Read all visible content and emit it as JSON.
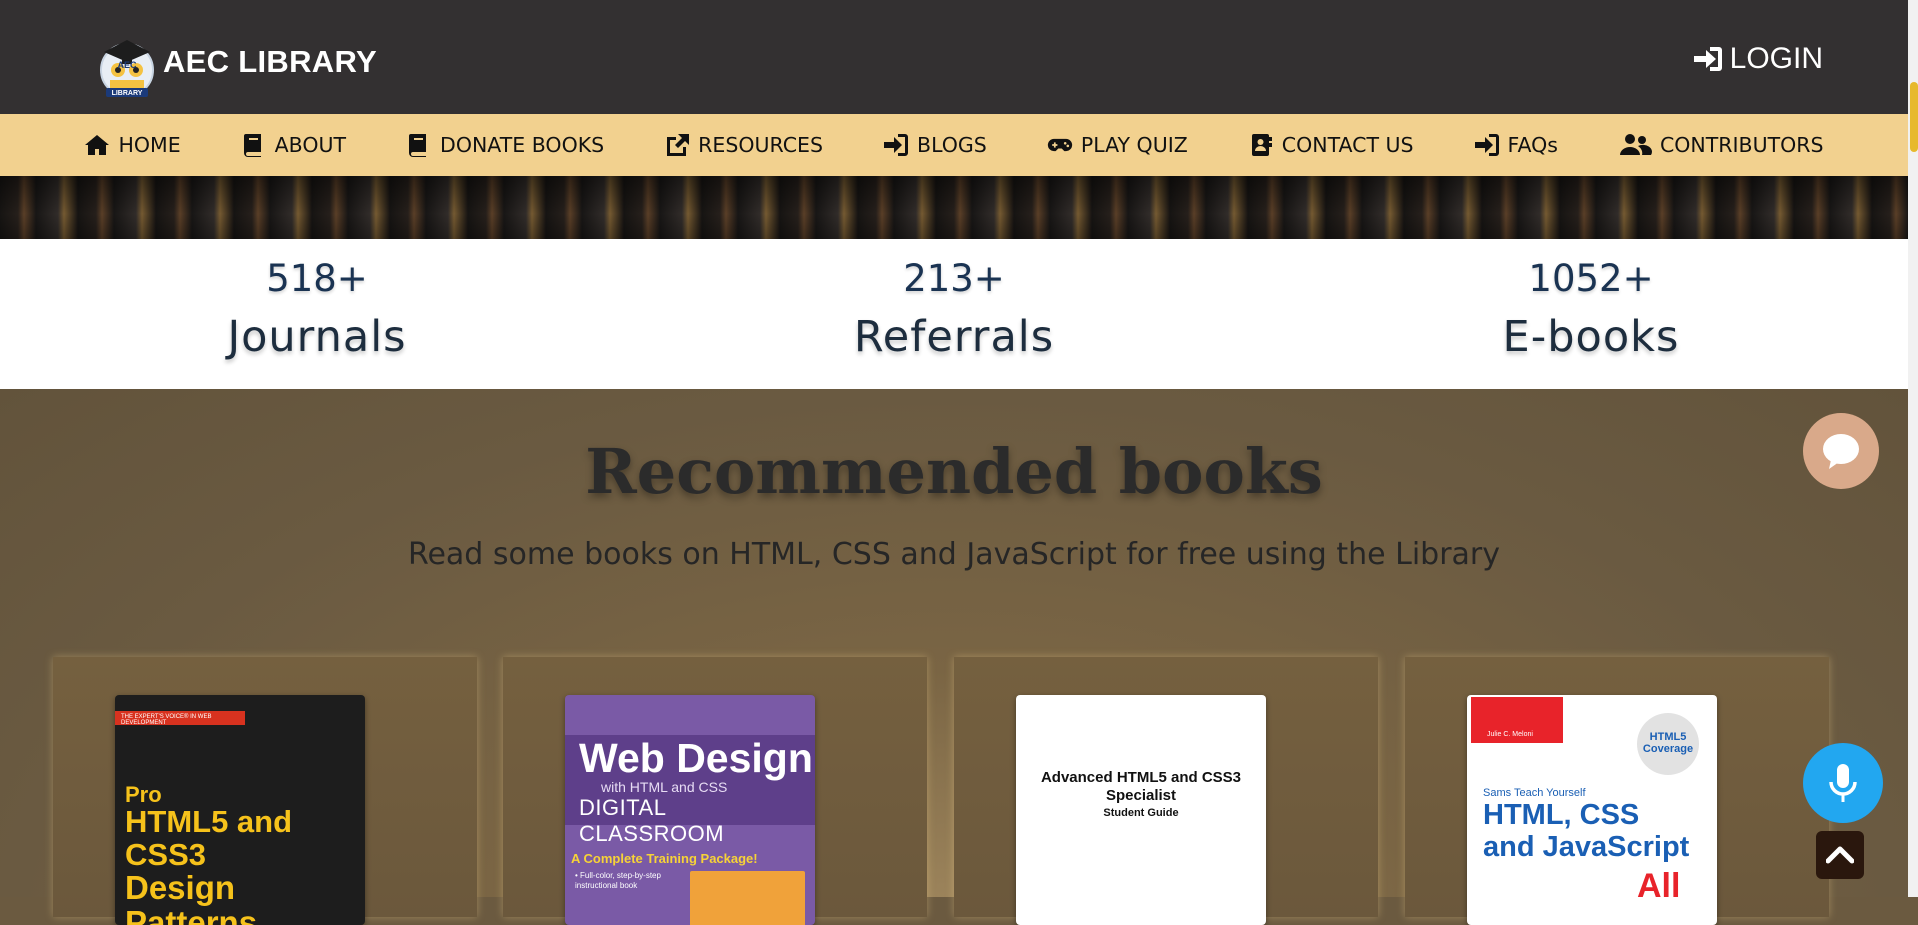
{
  "header": {
    "brand": "AEC LIBRARY",
    "logo_text_top": "AEC",
    "logo_text_bottom": "LIBRARY",
    "login_label": "LOGIN",
    "login_icon": "sign-in-icon"
  },
  "nav": {
    "items": [
      {
        "label": "HOME",
        "icon": "home-icon"
      },
      {
        "label": "ABOUT",
        "icon": "book-icon"
      },
      {
        "label": "DONATE BOOKS",
        "icon": "book-icon"
      },
      {
        "label": "RESOURCES",
        "icon": "external-link-icon"
      },
      {
        "label": "BLOGS",
        "icon": "sign-in-icon"
      },
      {
        "label": "PLAY QUIZ",
        "icon": "gamepad-icon"
      },
      {
        "label": "CONTACT US",
        "icon": "address-book-icon"
      },
      {
        "label": "FAQs",
        "icon": "sign-in-icon"
      },
      {
        "label": "CONTRIBUTORS",
        "icon": "users-icon"
      }
    ]
  },
  "stats": [
    {
      "value": "518+",
      "label": "Journals"
    },
    {
      "value": "213+",
      "label": "Referrals"
    },
    {
      "value": "1052+",
      "label": "E-books"
    }
  ],
  "recommended": {
    "title": "Recommended books",
    "subtitle": "Read some books on HTML, CSS and JavaScript for free using the Library",
    "books": [
      {
        "series_tag": "THE EXPERT'S VOICE® IN WEB DEVELOPMENT",
        "line1": "Pro",
        "line2": "HTML5 and CSS3",
        "line3": "Design Patterns"
      },
      {
        "line1": "Web Design",
        "line2": "with HTML and CSS",
        "line3": "DIGITAL CLASSROOM",
        "line4": "A Complete Training Package!",
        "line5": "• Full-color, step-by-step instructional book"
      },
      {
        "line1": "Advanced HTML5 and CSS3 Specialist",
        "line2": "Student Guide"
      },
      {
        "author": "Julie C. Meloni",
        "badge": "HTML5 Coverage",
        "series": "Sams Teach Yourself",
        "line1": "HTML, CSS",
        "line2": "and JavaScript",
        "line3": "All"
      }
    ]
  },
  "floating": {
    "chat_icon": "chat-bubble-icon",
    "mic_icon": "microphone-icon",
    "top_icon": "chevron-up-icon"
  },
  "colors": {
    "header_bg": "#333031",
    "nav_bg": "#f2d18f",
    "mic_bg": "#22a7f0",
    "chat_bg": "#d9a98a",
    "scroll_thumb": "#e7b92d"
  }
}
